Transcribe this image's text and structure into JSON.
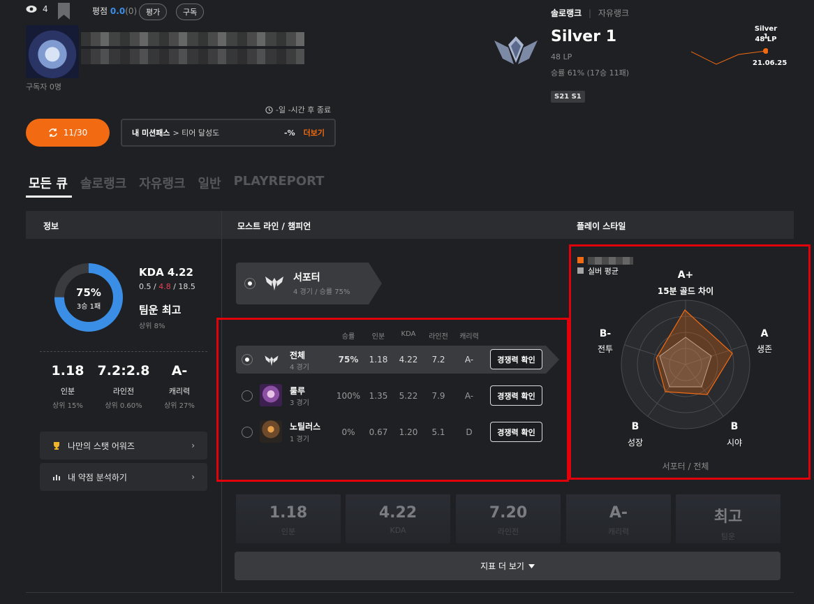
{
  "profile": {
    "view_count": "4",
    "rating_label": "평점",
    "rating_value": "0.0",
    "rating_count": "(0)",
    "rate_button": "평가",
    "subscribe_button": "구독",
    "subscribers": "구독자 0명",
    "cooldown_text": "-일 -시간 후 종료",
    "refresh_label": "11/30",
    "mission_label": "내 미션패스",
    "mission_sub": "> 티어 달성도",
    "mission_pct": "-%",
    "mission_more": "더보기"
  },
  "rank": {
    "tab_solo": "솔로랭크",
    "tab_flex": "자유랭크",
    "tier": "Silver 1",
    "lp": "48 LP",
    "winrate": "승률 61% (17승 11패)",
    "season_badge": "S21 S1",
    "graph_tier": "Silver 1",
    "graph_lp": "48 LP",
    "graph_date": "21.06.25"
  },
  "queue_tabs": [
    "모든 큐",
    "솔로랭크",
    "자유랭크",
    "일반",
    "PLAYREPORT"
  ],
  "section_headers": {
    "info": "정보",
    "most": "모스트 라인 / 챔피언",
    "style": "플레이 스타일"
  },
  "info": {
    "donut_pct": "75%",
    "donut_record": "3승 1패",
    "win_fraction": 0.75,
    "kda_title": "KDA 4.22",
    "kda_k": "0.5",
    "kda_d": "4.8",
    "kda_a": "18.5",
    "teamluck": "팀운 최고",
    "teamluck_rank": "상위 8%",
    "stats": [
      {
        "value": "1.18",
        "label": "인분",
        "rank": "상위 15%"
      },
      {
        "value": "7.2:2.8",
        "label": "라인전",
        "rank": "상위 0.60%"
      },
      {
        "value": "A-",
        "label": "캐리력",
        "rank": "상위 27%"
      }
    ],
    "links": [
      "나만의 스탯 어워즈",
      "내 약점 분석하기"
    ]
  },
  "most": {
    "lane_name": "서포터",
    "lane_sub": "4 경기 / 승률 75%",
    "columns": [
      "승률",
      "인분",
      "KDA",
      "라인전",
      "캐리력"
    ],
    "rows": [
      {
        "name": "전체",
        "games": "4 경기",
        "winrate": "75%",
        "inbun": "1.18",
        "kda": "4.22",
        "lane": "7.2",
        "carry": "A-",
        "btn": "경쟁력 확인"
      },
      {
        "name": "룰루",
        "games": "3 경기",
        "winrate": "100%",
        "inbun": "1.35",
        "kda": "5.22",
        "lane": "7.9",
        "carry": "A-",
        "btn": "경쟁력 확인"
      },
      {
        "name": "노틸러스",
        "games": "1 경기",
        "winrate": "0%",
        "inbun": "0.67",
        "kda": "1.20",
        "lane": "5.1",
        "carry": "D",
        "btn": "경쟁력 확인"
      }
    ]
  },
  "style": {
    "legend_avg": "실버 평균",
    "axes": [
      {
        "grade": "A+",
        "label": "15분 골드 차이"
      },
      {
        "grade": "A",
        "label": "생존"
      },
      {
        "grade": "B",
        "label": "시야"
      },
      {
        "grade": "B",
        "label": "성장"
      },
      {
        "grade": "B-",
        "label": "전투"
      }
    ],
    "footer": "서포터 / 전체"
  },
  "tiles": [
    {
      "value": "1.18",
      "label": "인분"
    },
    {
      "value": "4.22",
      "label": "KDA"
    },
    {
      "value": "7.20",
      "label": "라인전"
    },
    {
      "value": "A-",
      "label": "캐리력"
    },
    {
      "value": "최고",
      "label": "팀운"
    }
  ],
  "more_button": "지표 더 보기",
  "colors": {
    "accent": "#f26b12",
    "blue": "#3a8ee6",
    "red": "#e84057"
  }
}
